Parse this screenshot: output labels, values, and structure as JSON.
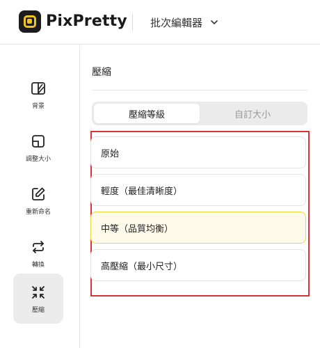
{
  "header": {
    "brand": "PixPretty",
    "editor_switch_label": "批次編輯器"
  },
  "sidebar": {
    "items": [
      {
        "label": "背景",
        "icon": "background-icon",
        "active": false
      },
      {
        "label": "調整大小",
        "icon": "resize-icon",
        "active": false
      },
      {
        "label": "重新命名",
        "icon": "rename-icon",
        "active": false
      },
      {
        "label": "轉換",
        "icon": "convert-icon",
        "active": false
      },
      {
        "label": "壓縮",
        "icon": "compress-icon",
        "active": true
      }
    ]
  },
  "main": {
    "title": "壓縮",
    "segmented": {
      "options": [
        "壓縮等級",
        "自訂大小"
      ],
      "selected": "壓縮等級"
    },
    "compression_levels": [
      {
        "label": "原始",
        "selected": false
      },
      {
        "label": "輕度（最佳清晰度）",
        "selected": false
      },
      {
        "label": "中等（品質均衡）",
        "selected": true
      },
      {
        "label": "高壓縮（最小尺寸）",
        "selected": false
      }
    ]
  },
  "colors": {
    "brand_accent": "#f2c320",
    "selected_option_bg": "#fffbea",
    "selected_option_border": "#f0d63a",
    "highlight_frame": "#d8323a"
  }
}
